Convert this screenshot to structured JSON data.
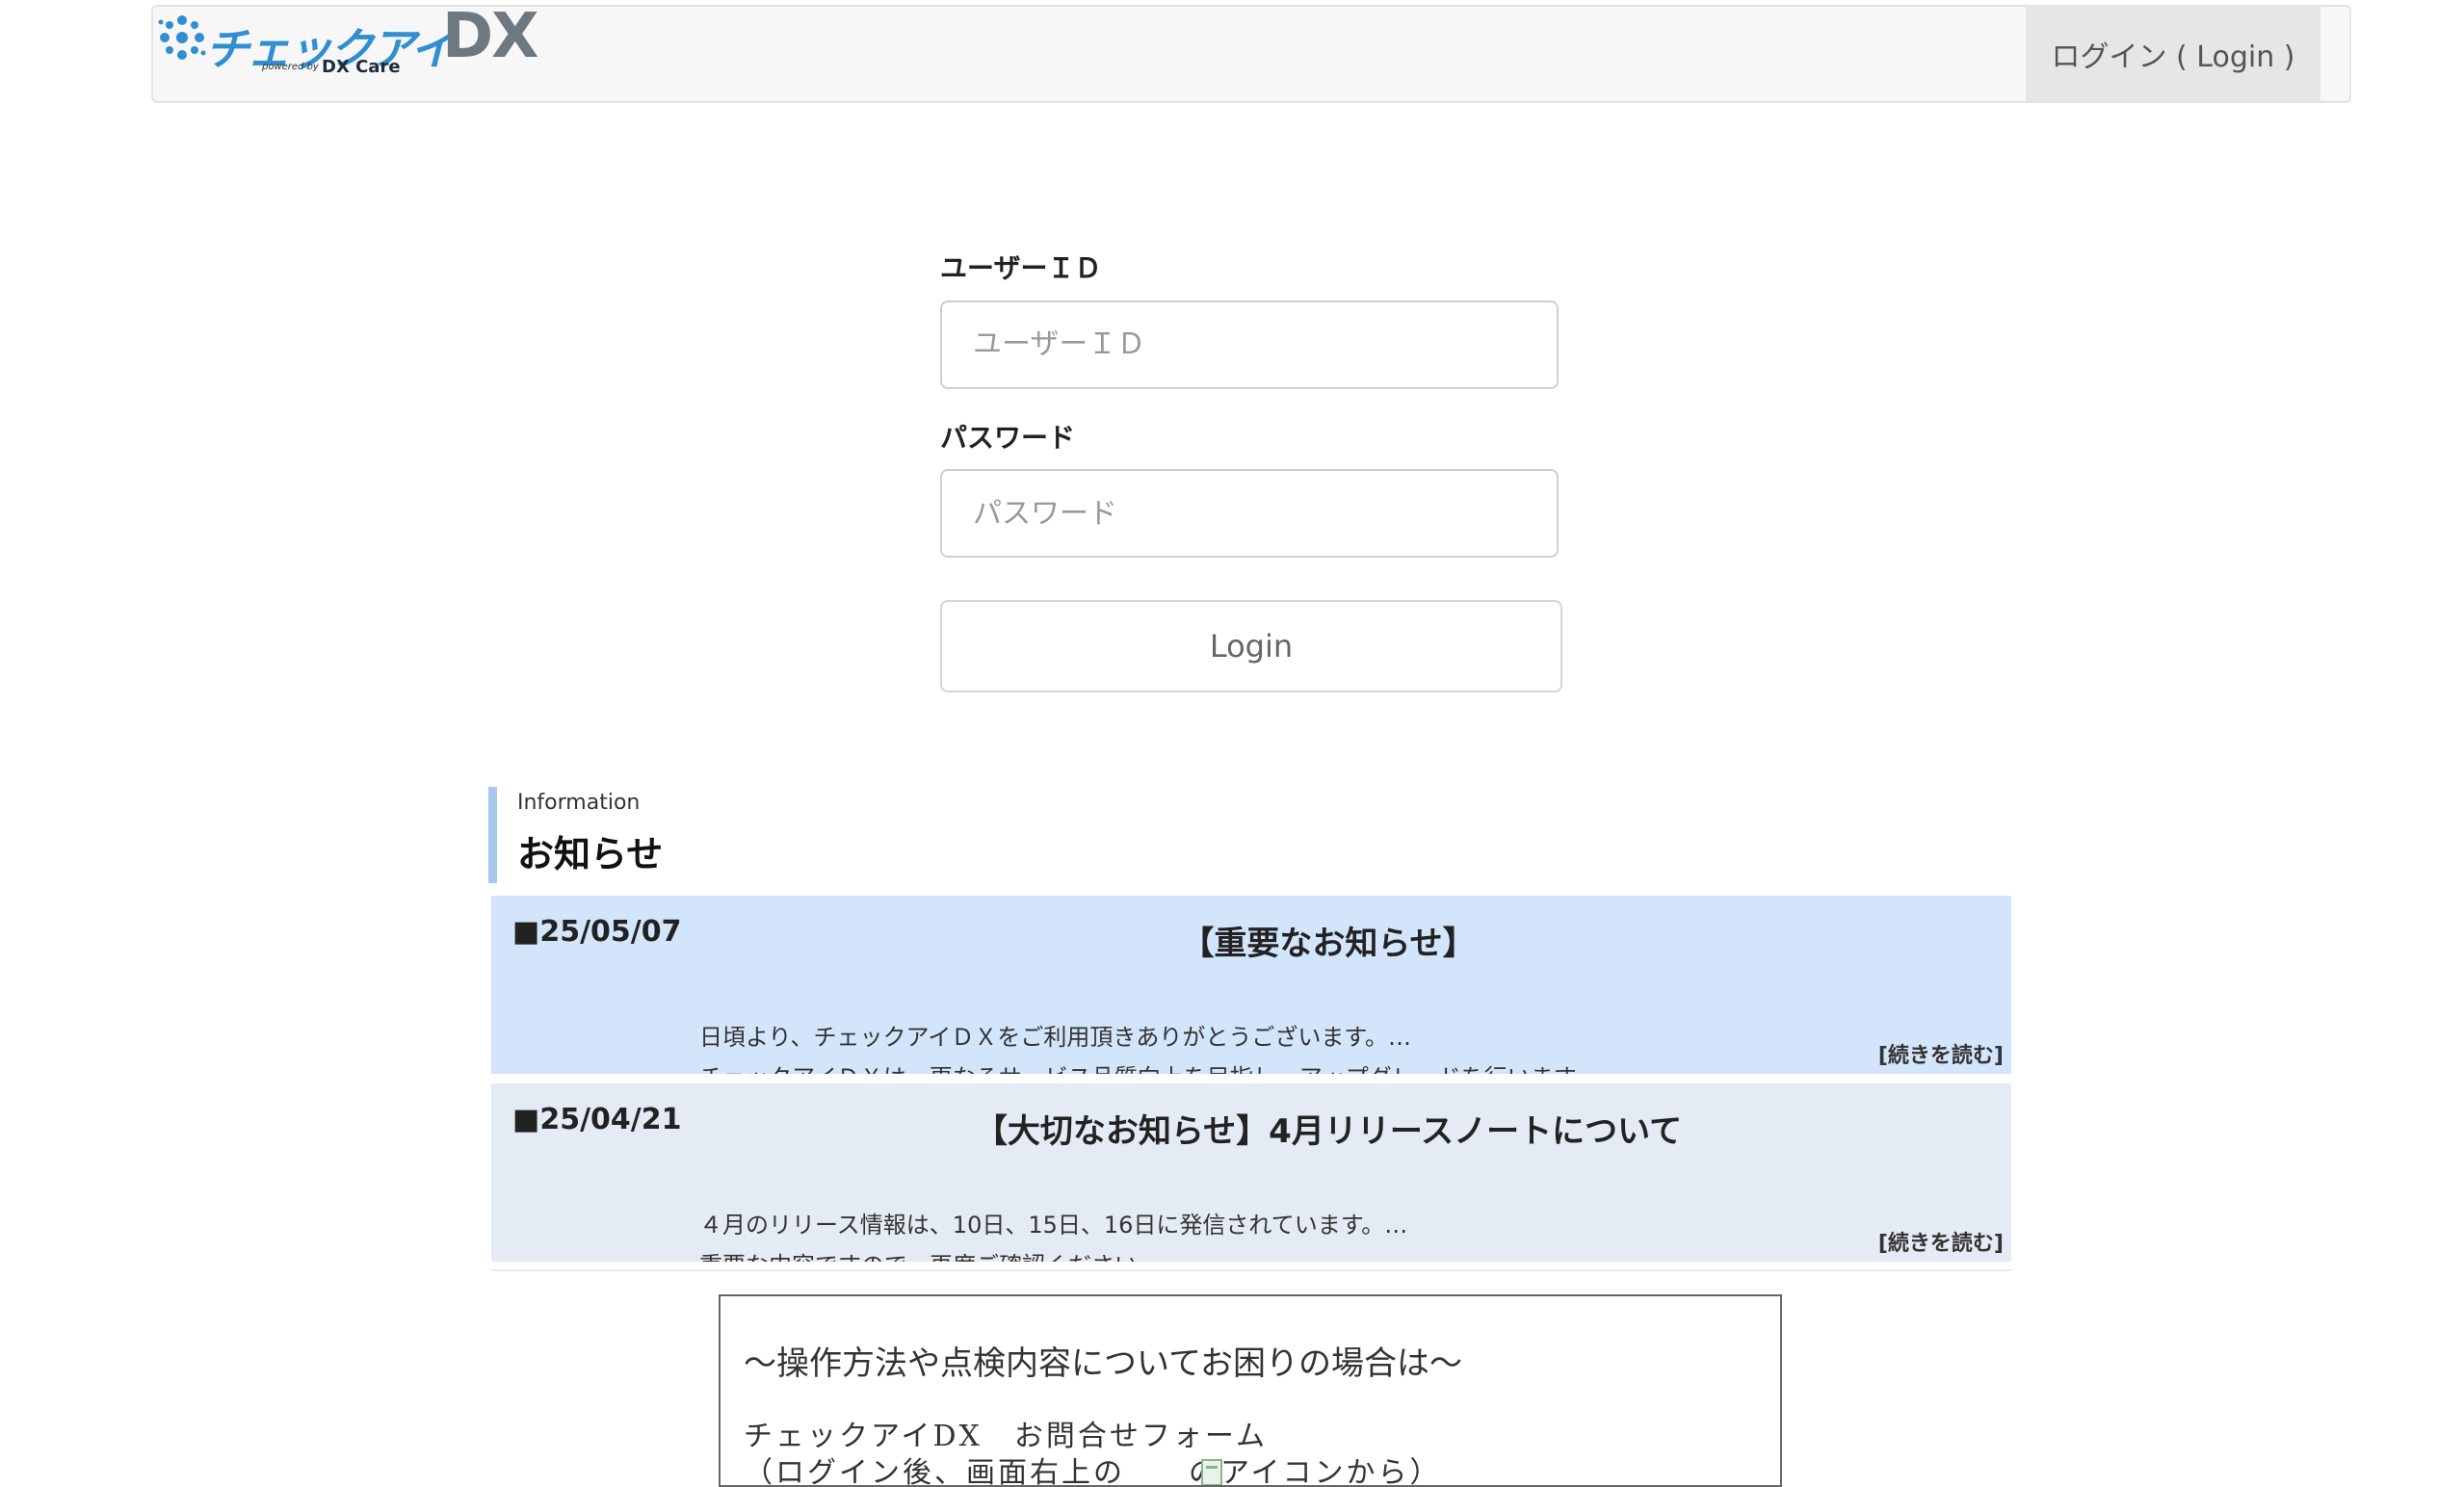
{
  "header": {
    "logo_main": "チェックアイ",
    "logo_dx": "DX",
    "logo_powered": "powered by",
    "logo_brand": "DX Care",
    "login_link": "ログイン ( Login )"
  },
  "form": {
    "user_id_label": "ユーザーＩＤ",
    "user_id_placeholder": "ユーザーＩＤ",
    "password_label": "パスワード",
    "password_placeholder": "パスワード",
    "login_button": "Login"
  },
  "information": {
    "subtitle": "Information",
    "title": "お知らせ",
    "items": [
      {
        "date": "■25/05/07",
        "title": "【重要なお知らせ】",
        "body_line1": "日頃より、チェックアイＤＸをご利用頂きありがとうございます。…",
        "body_line2": "チェックアイＤＸは、更なるサービス品質向上を目指し、アップグレードを行います",
        "more": "[続きを読む]"
      },
      {
        "date": "■25/04/21",
        "title": "【大切なお知らせ】4月リリースノートについて",
        "body_line1": "４月のリリース情報は、10日、15日、16日に発信されています。…",
        "body_line2": "重要な内容ですので、再度ご確認ください",
        "more": "[続きを読む]"
      }
    ]
  },
  "contact": {
    "line1": "～操作方法や点検内容についてお困りの場合は～",
    "line2": "チェックアイDX　お問合せフォーム",
    "line3": "（ログイン後、画面右上の　　のアイコンから）"
  },
  "colors": {
    "logo_blue": "#2f8fd1",
    "news_highlight": "#d3e5fa",
    "news_default": "#e4ebf4",
    "info_accent": "#a9c7ee"
  }
}
